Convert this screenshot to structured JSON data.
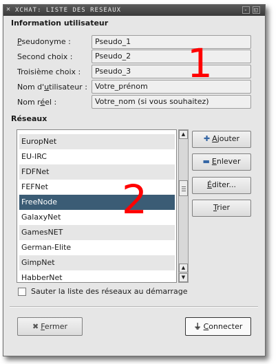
{
  "titlebar": {
    "title": "XCHAT: LISTE DES RESEAUX",
    "icon": "x-icon",
    "btn_left": "-",
    "btn_right": "◱"
  },
  "user_info": {
    "title": "Information utilisateur",
    "fields": [
      {
        "label": "Pseudonyme :",
        "value": "Pseudo_1"
      },
      {
        "label": "Second choix :",
        "value": "Pseudo_2"
      },
      {
        "label": "Troisième choix :",
        "value": "Pseudo_3"
      },
      {
        "label": "Nom d'utilisateur :",
        "value": "Votre_prénom"
      },
      {
        "label": "Nom réel :",
        "value": "Votre_nom (si vous souhaitez)"
      }
    ],
    "annotation": "1"
  },
  "networks": {
    "title": "Réseaux",
    "items": [
      "EuropNet",
      "EU-IRC",
      "FDFNet",
      "FEFNet",
      "FreeNode",
      "GalaxyNet",
      "GamesNET",
      "German-Elite",
      "GimpNet",
      "HabberNet"
    ],
    "selected": "FreeNode",
    "annotation": "2",
    "buttons": {
      "add": "Ajouter",
      "remove": "Enlever",
      "edit": "Éditer...",
      "sort": "Trier"
    }
  },
  "skip_list": {
    "label": "Sauter la liste des réseaux au démarrage",
    "checked": false
  },
  "footer": {
    "close": "Fermer",
    "connect": "Connecter"
  },
  "colors": {
    "selection": "#3b5c75",
    "annotation": "#ff0000"
  }
}
